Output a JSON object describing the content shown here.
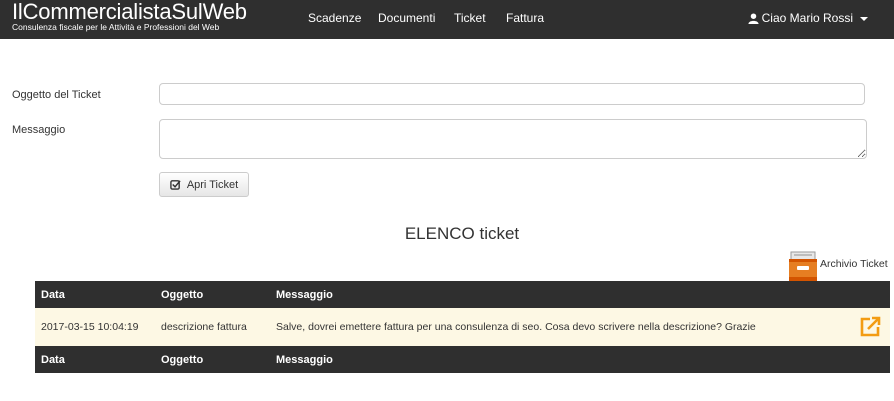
{
  "brand": {
    "title": "IlCommercialistaSulWeb",
    "subtitle": "Consulenza fiscale per le Attività e Professioni del Web"
  },
  "nav": {
    "items": [
      {
        "label": "Scadenze"
      },
      {
        "label": "Documenti"
      },
      {
        "label": "Ticket"
      },
      {
        "label": "Fattura"
      }
    ],
    "user_label": "Ciao Mario Rossi"
  },
  "form": {
    "subject_label": "Oggetto del Ticket",
    "subject_value": "",
    "message_label": "Messaggio",
    "message_value": "",
    "submit_label": "Apri Ticket"
  },
  "list": {
    "title": "ELENCO ticket",
    "archive_label": "Archivio Ticket",
    "columns": [
      "Data",
      "Oggetto",
      "Messaggio"
    ],
    "rows": [
      {
        "data": "2017-03-15 10:04:19",
        "oggetto": "descrizione fattura",
        "messaggio": "Salve, dovrei emettere fattura per una consulenza di seo. Cosa devo scrivere nella descrizione? Grazie"
      }
    ]
  },
  "colors": {
    "navbar": "#2f2f2f",
    "row_highlight": "#fdf8e4",
    "accent": "#f39c12"
  }
}
